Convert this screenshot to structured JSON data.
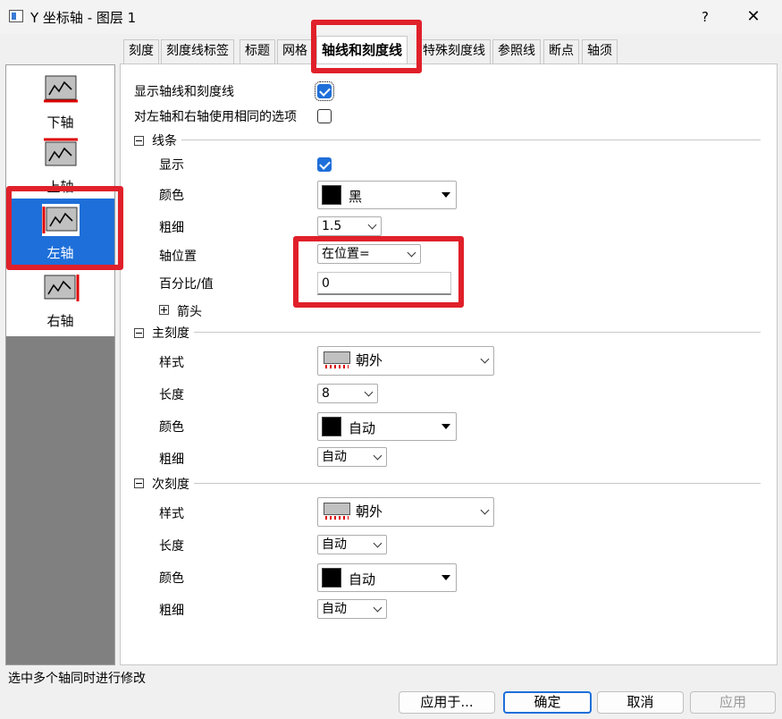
{
  "window": {
    "title": "Y 坐标轴 - 图层 1",
    "help": "?",
    "close": "✕"
  },
  "tabs": [
    "刻度",
    "刻度线标签",
    "标题",
    "网格",
    "轴线和刻度线",
    "特殊刻度线",
    "参照线",
    "断点",
    "轴须"
  ],
  "axes": [
    "下轴",
    "上轴",
    "左轴",
    "右轴"
  ],
  "options": {
    "show_axis_label": "显示轴线和刻度线",
    "same_options_label": "对左轴和右轴使用相同的选项"
  },
  "line": {
    "header": "线条",
    "show_label": "显示",
    "color_label": "颜色",
    "color_value": "黑",
    "thickness_label": "粗细",
    "thickness_value": "1.5",
    "position_label": "轴位置",
    "position_value": "在位置=",
    "percent_label": "百分比/值",
    "percent_value": "0",
    "arrow_label": "箭头"
  },
  "major": {
    "header": "主刻度",
    "style_label": "样式",
    "style_value": "朝外",
    "length_label": "长度",
    "length_value": "8",
    "color_label": "颜色",
    "color_value": "自动",
    "thickness_label": "粗细",
    "thickness_value": "自动"
  },
  "minor": {
    "header": "次刻度",
    "style_label": "样式",
    "style_value": "朝外",
    "length_label": "长度",
    "length_value": "自动",
    "color_label": "颜色",
    "color_value": "自动",
    "thickness_label": "粗细",
    "thickness_value": "自动"
  },
  "footer": {
    "status": "选中多个轴同时进行修改",
    "apply_to": "应用于...",
    "ok": "确定",
    "cancel": "取消",
    "apply": "应用"
  },
  "colors": {
    "accent": "#1e6fd9",
    "highlight": "#e0202a",
    "tick_red": "#dd0000"
  }
}
